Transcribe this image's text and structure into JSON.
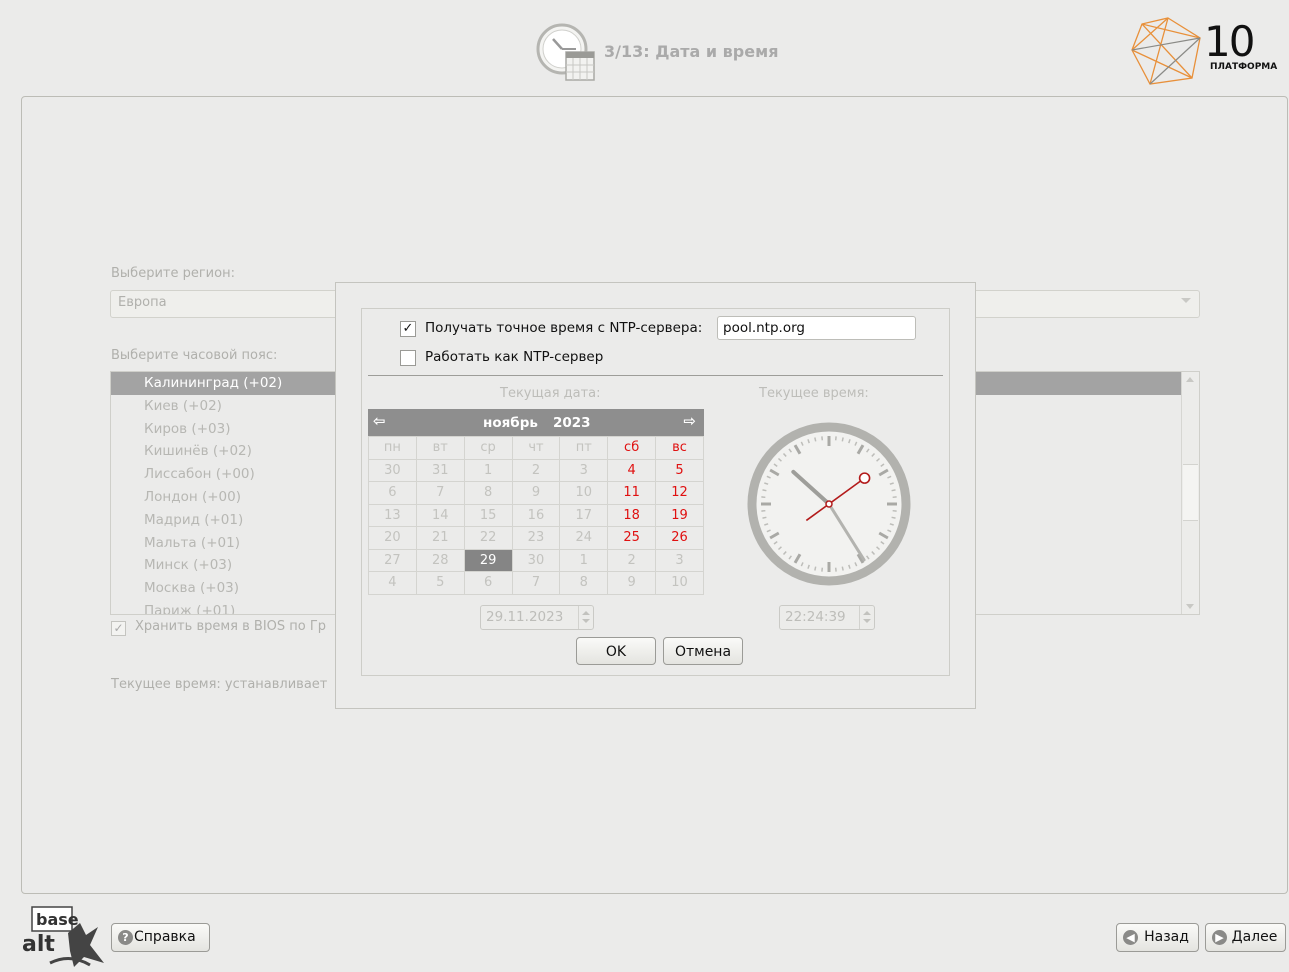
{
  "header": {
    "title": "3/13: Дата и время",
    "brand_number": "10",
    "brand_name": "ПЛАТФОРМА"
  },
  "main": {
    "region_label": "Выберите регион:",
    "region_value": "Европа",
    "timezone_label": "Выберите часовой пояс:",
    "timezones": [
      {
        "label": "Калининград (+02)",
        "selected": true
      },
      {
        "label": "Киев (+02)",
        "selected": false
      },
      {
        "label": "Киров (+03)",
        "selected": false
      },
      {
        "label": "Кишинёв (+02)",
        "selected": false
      },
      {
        "label": "Лиссабон (+00)",
        "selected": false
      },
      {
        "label": "Лондон (+00)",
        "selected": false
      },
      {
        "label": "Мадрид (+01)",
        "selected": false
      },
      {
        "label": "Мальта (+01)",
        "selected": false
      },
      {
        "label": "Минск (+03)",
        "selected": false
      },
      {
        "label": "Москва (+03)",
        "selected": false
      },
      {
        "label": "Париж (+01)",
        "selected": false
      }
    ],
    "bios_utc_label": "Хранить время в BIOS по Гр",
    "bios_utc_checked": true,
    "current_time_label": "Текущее время: устанавливает"
  },
  "dialog": {
    "ntp_client_label": "Получать точное время с NTP-сервера:",
    "ntp_client_checked": true,
    "ntp_server_value": "pool.ntp.org",
    "ntp_server_mode_label": "Работать как NTP-сервер",
    "ntp_server_mode_checked": false,
    "date_caption": "Текущая дата:",
    "time_caption": "Текущее время:",
    "calendar": {
      "month": "ноябрь",
      "year": "2023",
      "weekdays": [
        "пн",
        "вт",
        "ср",
        "чт",
        "пт",
        "сб",
        "вс"
      ],
      "weeks": [
        [
          "30",
          "31",
          "1",
          "2",
          "3",
          "4",
          "5"
        ],
        [
          "6",
          "7",
          "8",
          "9",
          "10",
          "11",
          "12"
        ],
        [
          "13",
          "14",
          "15",
          "16",
          "17",
          "18",
          "19"
        ],
        [
          "20",
          "21",
          "22",
          "23",
          "24",
          "25",
          "26"
        ],
        [
          "27",
          "28",
          "29",
          "30",
          "1",
          "2",
          "3"
        ],
        [
          "4",
          "5",
          "6",
          "7",
          "8",
          "9",
          "10"
        ]
      ],
      "selected_day": "29"
    },
    "date_value": "29.11.2023",
    "time_value": "22:24:39",
    "clock": {
      "hours": 22,
      "minutes": 24,
      "seconds": 39
    },
    "ok_label": "OK",
    "cancel_label": "Отмена"
  },
  "footer": {
    "help_label": "Справка",
    "back_label": "Назад",
    "next_label": "Далее"
  },
  "colors": {
    "background": "#ebebea",
    "weekend": "#e01010",
    "selected_row": "#a3a3a3"
  }
}
